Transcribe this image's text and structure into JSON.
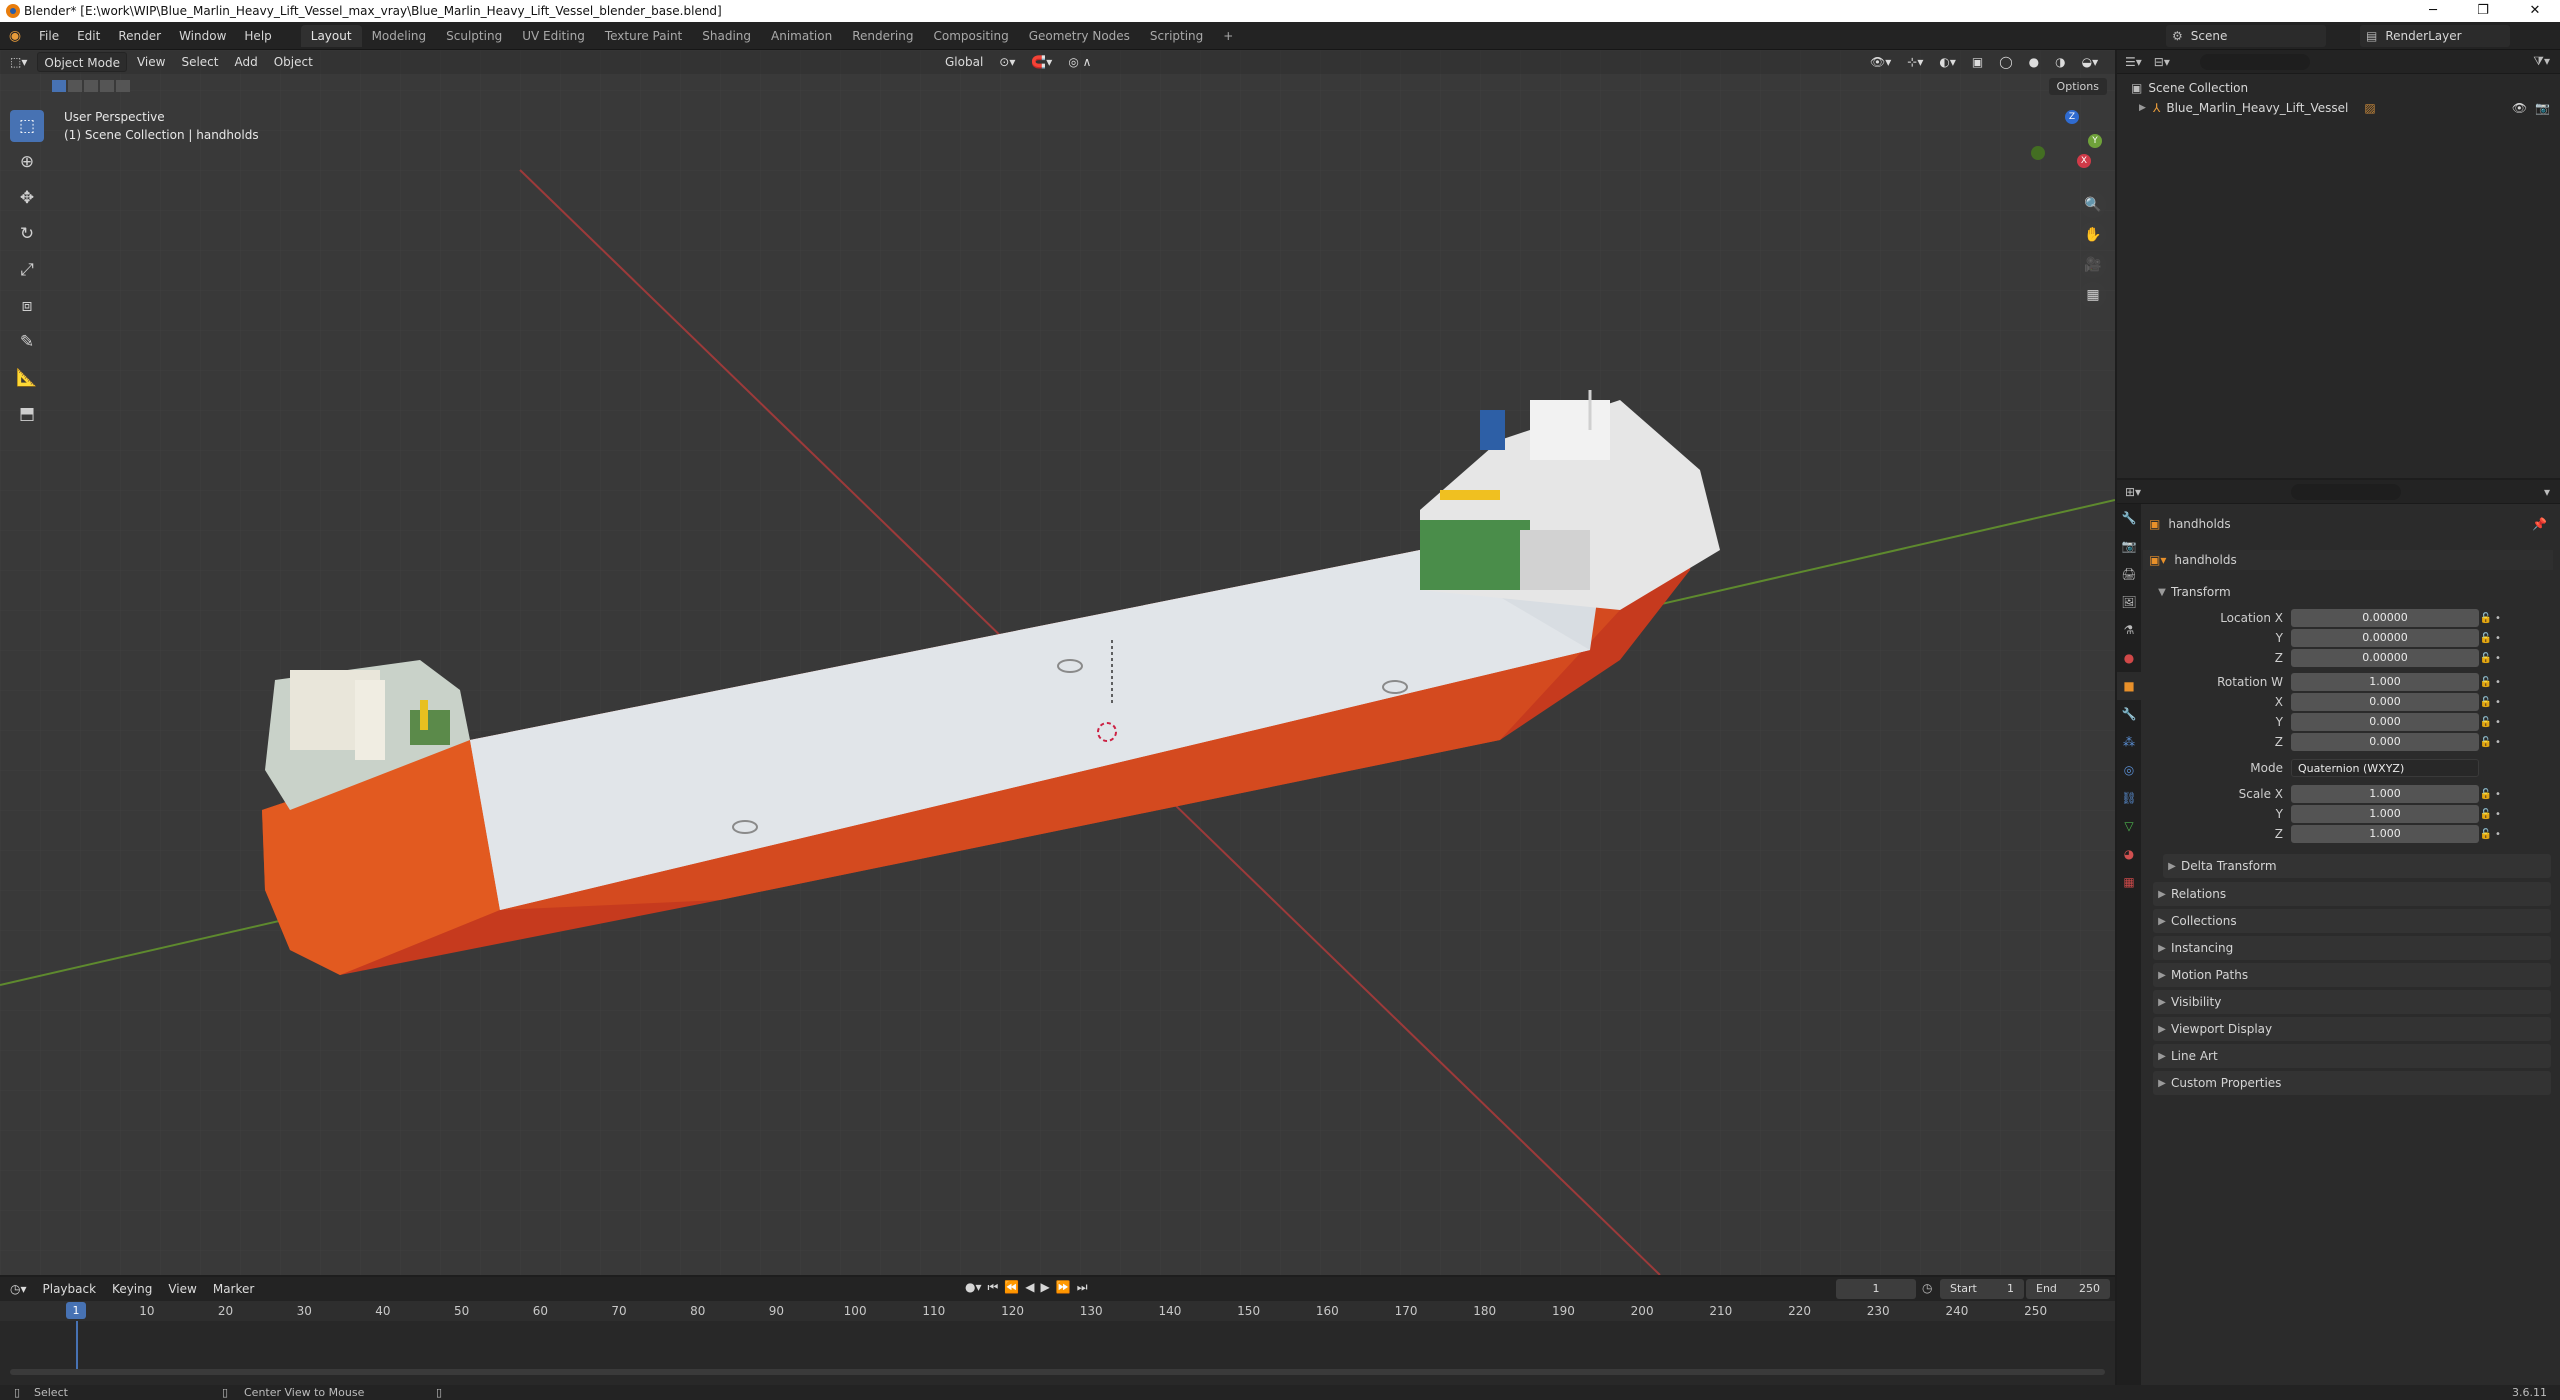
{
  "window": {
    "title": "Blender* [E:\\work\\WIP\\Blue_Marlin_Heavy_Lift_Vessel_max_vray\\Blue_Marlin_Heavy_Lift_Vessel_blender_base.blend]",
    "minimize": "─",
    "maximize": "❐",
    "close": "✕"
  },
  "menu": [
    "File",
    "Edit",
    "Render",
    "Window",
    "Help"
  ],
  "workspaces": [
    "Layout",
    "Modeling",
    "Sculpting",
    "UV Editing",
    "Texture Paint",
    "Shading",
    "Animation",
    "Rendering",
    "Compositing",
    "Geometry Nodes",
    "Scripting"
  ],
  "workspace_add": "+",
  "scene_name": "Scene",
  "render_layer": "RenderLayer",
  "viewport": {
    "mode": "Object Mode",
    "menus": [
      "View",
      "Select",
      "Add",
      "Object"
    ],
    "orientation": "Global",
    "perspective_label": "User Perspective",
    "collection_label": "(1) Scene Collection | handholds",
    "options": "Options",
    "gizmo_x": "X",
    "gizmo_y": "Y",
    "gizmo_z": "Z"
  },
  "outliner": {
    "root": "Scene Collection",
    "items": [
      "Blue_Marlin_Heavy_Lift_Vessel"
    ]
  },
  "properties": {
    "object_name": "handholds",
    "data_name": "handholds",
    "section": "Transform",
    "location": {
      "label": "Location X",
      "x": "0.00000",
      "y": "0.00000",
      "z": "0.00000"
    },
    "rotation": {
      "label": "Rotation W",
      "w": "1.000",
      "x": "0.000",
      "y": "0.000",
      "z": "0.000"
    },
    "axis": {
      "x": "X",
      "y": "Y",
      "z": "Z"
    },
    "mode_label": "Mode",
    "mode_value": "Quaternion (WXYZ)",
    "scale": {
      "label": "Scale X",
      "x": "1.000",
      "y": "1.000",
      "z": "1.000"
    },
    "delta": "Delta Transform",
    "panels": [
      "Relations",
      "Collections",
      "Instancing",
      "Motion Paths",
      "Visibility",
      "Viewport Display",
      "Line Art",
      "Custom Properties"
    ]
  },
  "timeline": {
    "menus": [
      "Playback",
      "Keying",
      "View",
      "Marker"
    ],
    "current_frame": "1",
    "start_label": "Start",
    "start": "1",
    "end_label": "End",
    "end": "250",
    "ticks": [
      "10",
      "20",
      "30",
      "40",
      "50",
      "60",
      "70",
      "80",
      "90",
      "100",
      "110",
      "120",
      "130",
      "140",
      "150",
      "160",
      "170",
      "180",
      "190",
      "200",
      "210",
      "220",
      "230",
      "240",
      "250"
    ],
    "playhead": "1"
  },
  "status": {
    "left": "Select",
    "middle": "Center View to Mouse",
    "version": "3.6.11"
  }
}
